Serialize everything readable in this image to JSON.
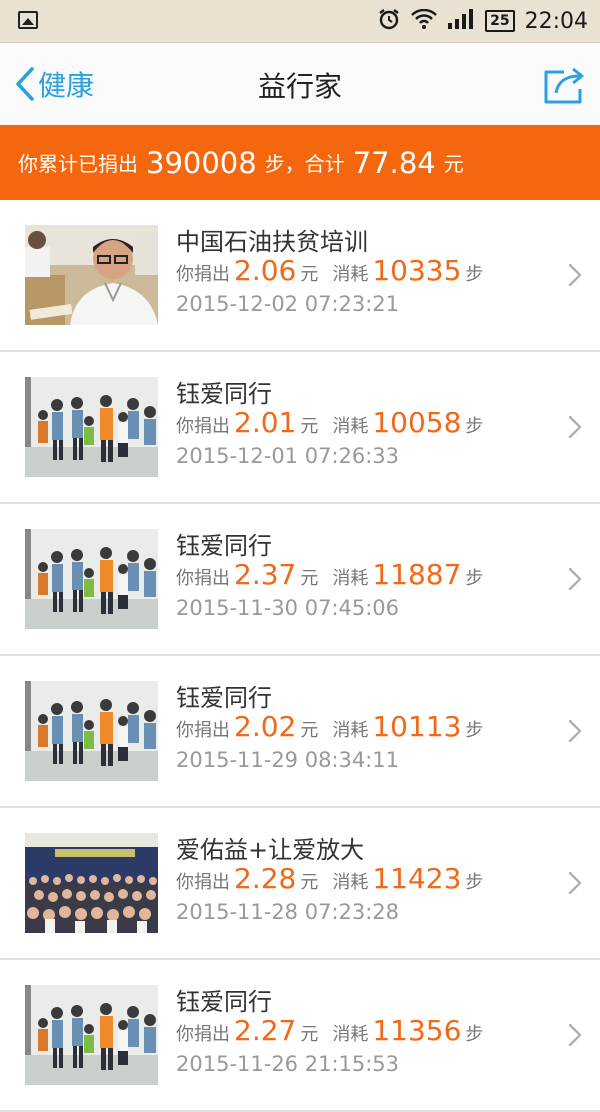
{
  "status_bar": {
    "time": "22:04",
    "battery": "25",
    "icons": [
      "image-icon",
      "alarm-icon",
      "wifi-icon",
      "signal-icon",
      "battery-icon"
    ]
  },
  "nav": {
    "back_label": "健康",
    "title": "益行家",
    "share_icon": "share-icon"
  },
  "summary": {
    "prefix": "你累计已捐出",
    "steps": "390008",
    "steps_unit": "步，合计",
    "amount": "77.84",
    "amount_unit": "元"
  },
  "labels": {
    "donate": "你捐出",
    "yuan": "元",
    "consume": "消耗",
    "steps": "步"
  },
  "items": [
    {
      "title": "中国石油扶贫培训",
      "amount": "2.06",
      "steps": "10335",
      "date": "2015-12-02 07:23:21",
      "thumb": "man-portrait"
    },
    {
      "title": "钰爱同行",
      "amount": "2.01",
      "steps": "10058",
      "date": "2015-12-01 07:26:33",
      "thumb": "children-group"
    },
    {
      "title": "钰爱同行",
      "amount": "2.37",
      "steps": "11887",
      "date": "2015-11-30 07:45:06",
      "thumb": "children-group"
    },
    {
      "title": "钰爱同行",
      "amount": "2.02",
      "steps": "10113",
      "date": "2015-11-29 08:34:11",
      "thumb": "children-group"
    },
    {
      "title": "爱佑益+让爱放大",
      "amount": "2.28",
      "steps": "11423",
      "date": "2015-11-28 07:23:28",
      "thumb": "crowd-photo"
    },
    {
      "title": "钰爱同行",
      "amount": "2.27",
      "steps": "11356",
      "date": "2015-11-26 21:15:53",
      "thumb": "children-group"
    }
  ],
  "colors": {
    "accent_orange": "#f4670f",
    "number_orange": "#ee6a1a",
    "link_blue": "#2aa0dc"
  }
}
